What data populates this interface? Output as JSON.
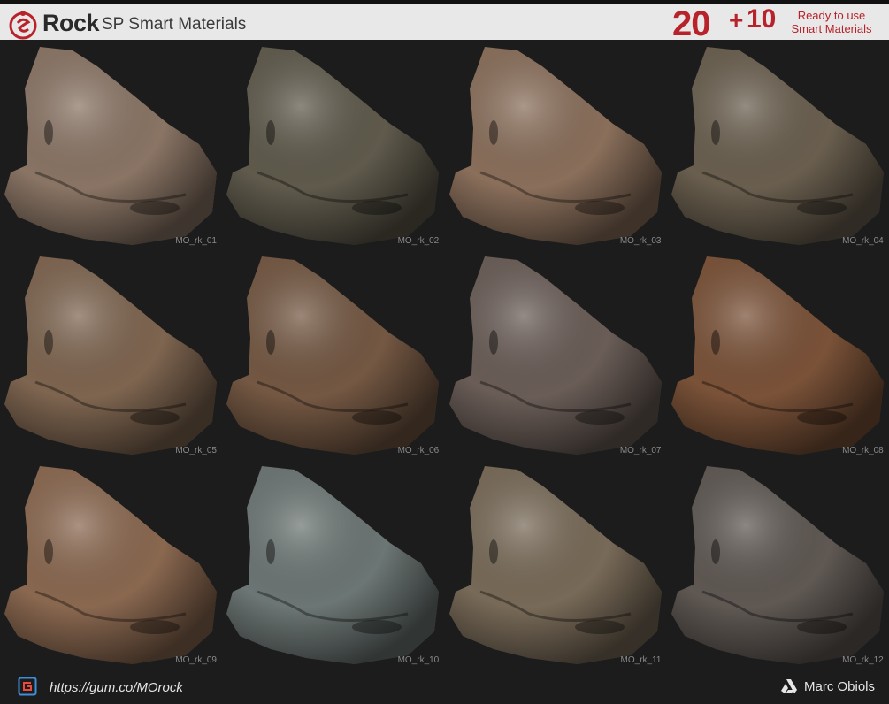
{
  "header": {
    "title": "Rock",
    "subtitle": "SP Smart Materials",
    "count_main": "20",
    "count_plus": "+",
    "count_extra": "10",
    "tagline_line1": "Ready to use",
    "tagline_line2": "Smart Materials",
    "accent_color": "#b8222a",
    "logo_icon": "substance-painter-logo"
  },
  "materials": [
    {
      "name": "MO_rk_01",
      "color": "#8a7565"
    },
    {
      "name": "MO_rk_02",
      "color": "#5f5a4c"
    },
    {
      "name": "MO_rk_03",
      "color": "#8a6f5b"
    },
    {
      "name": "MO_rk_04",
      "color": "#6a5f4f"
    },
    {
      "name": "MO_rk_05",
      "color": "#7e6550"
    },
    {
      "name": "MO_rk_06",
      "color": "#745843"
    },
    {
      "name": "MO_rk_07",
      "color": "#6a5d57"
    },
    {
      "name": "MO_rk_08",
      "color": "#7a5238"
    },
    {
      "name": "MO_rk_09",
      "color": "#8a6850"
    },
    {
      "name": "MO_rk_10",
      "color": "#6c7674"
    },
    {
      "name": "MO_rk_11",
      "color": "#786a58"
    },
    {
      "name": "MO_rk_12",
      "color": "#5f5853"
    }
  ],
  "footer": {
    "url": "https://gum.co/MOrock",
    "author": "Marc Obiols",
    "gum_icon": "gumroad-icon",
    "author_icon": "artstation-icon"
  }
}
